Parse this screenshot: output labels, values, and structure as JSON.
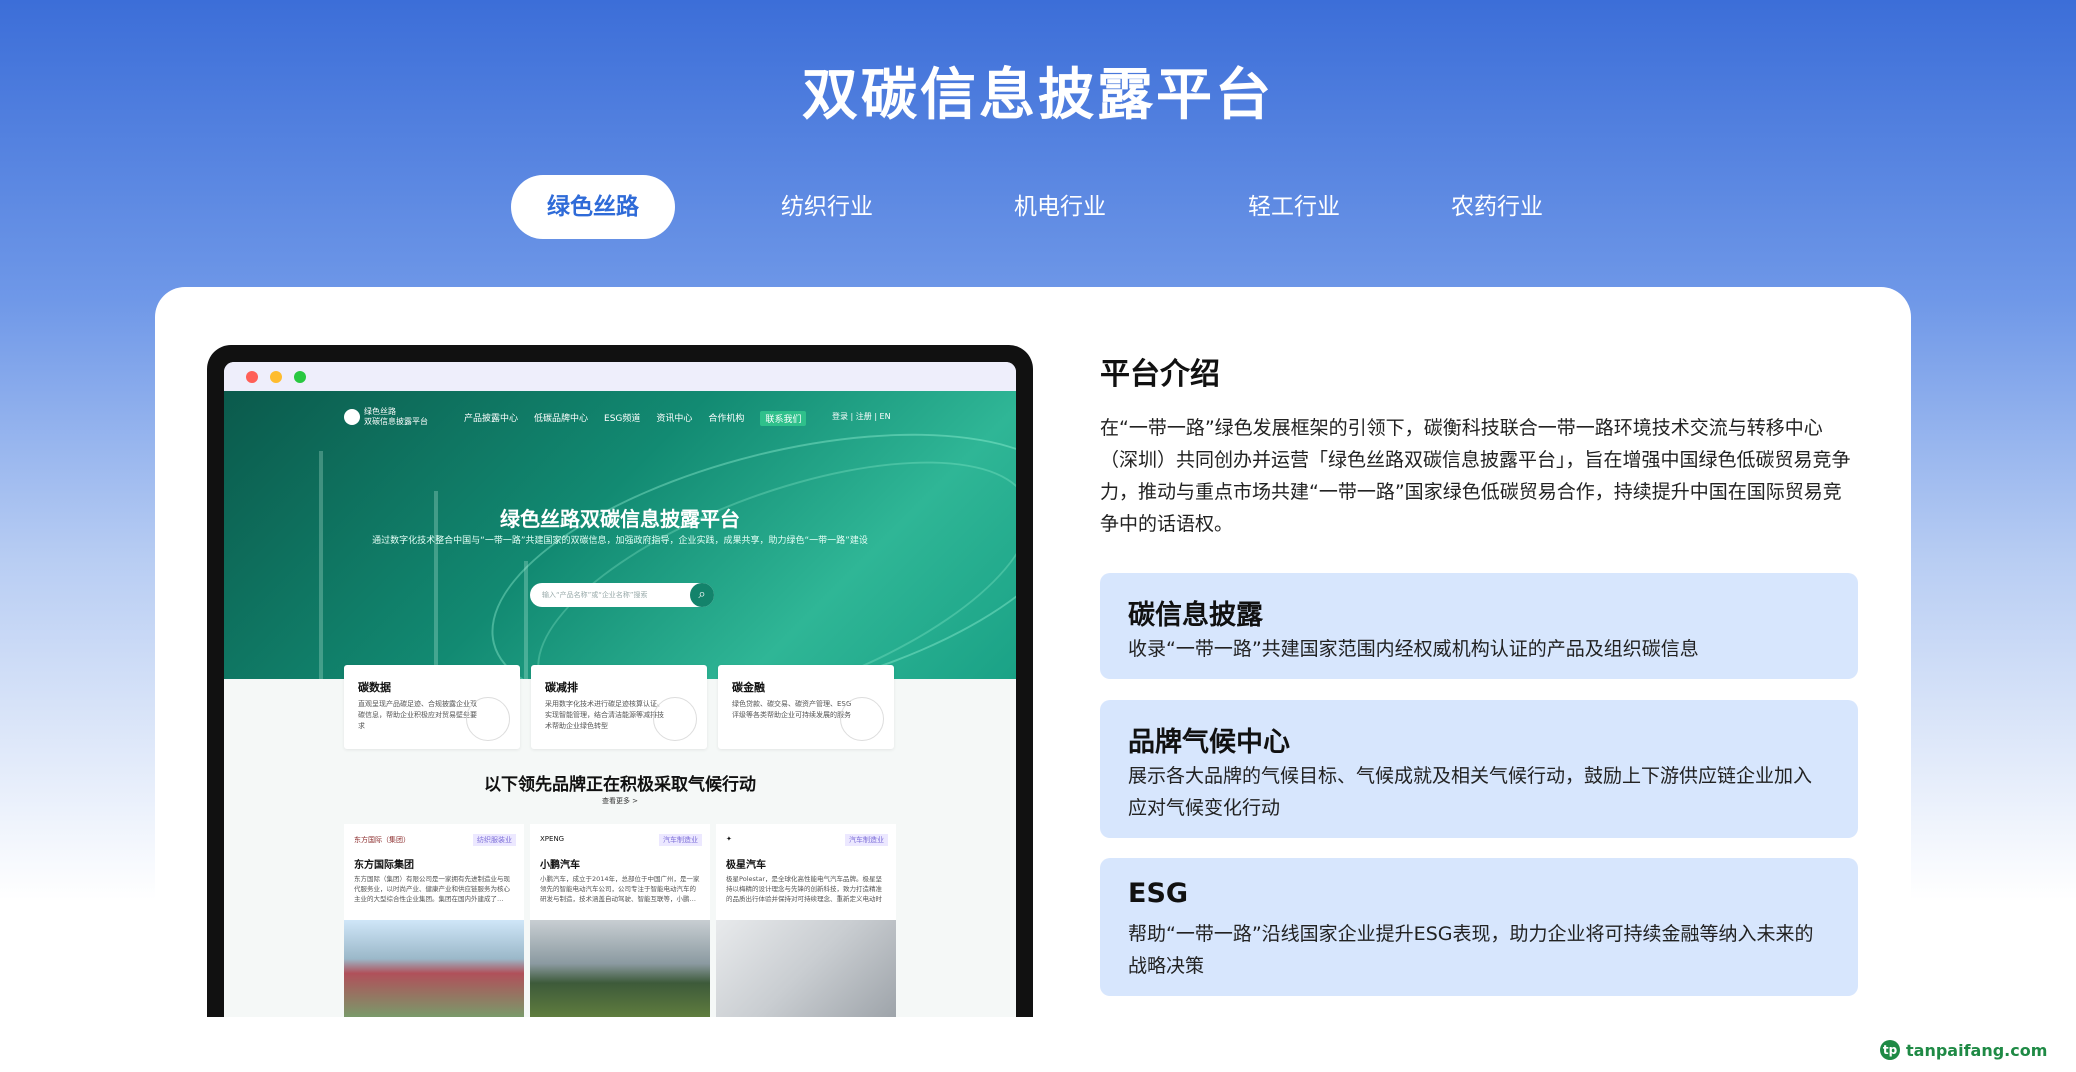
{
  "page_title": "双碳信息披露平台",
  "tabs": [
    {
      "label": "绿色丝路",
      "active": true
    },
    {
      "label": "纺织行业",
      "active": false
    },
    {
      "label": "机电行业",
      "active": false
    },
    {
      "label": "轻工行业",
      "active": false
    },
    {
      "label": "农药行业",
      "active": false
    }
  ],
  "mockup": {
    "logo_line1": "绿色丝路",
    "logo_line2": "双碳信息披露平台",
    "nav": [
      "产品披露中心",
      "低碳品牌中心",
      "ESG频道",
      "资讯中心",
      "合作机构"
    ],
    "nav_cta": "联系我们",
    "login": "登录 | 注册 | EN",
    "hero_title": "绿色丝路双碳信息披露平台",
    "hero_sub": "通过数字化技术整合中国与“一带一路”共建国家的双碳信息，加强政府指导，企业实践，成果共享，助力绿色“一带一路”建设",
    "search_placeholder": "输入“产品名称”或“企业名称”搜索",
    "features": [
      {
        "title": "碳数据",
        "desc": "直观呈现产品碳足迹、合规披露企业双碳信息，帮助企业积极应对贸易壁垒要求"
      },
      {
        "title": "碳减排",
        "desc": "采用数字化技术进行碳足迹核算认证、实现智能管理，结合清洁能源等减排技术帮助企业绿色转型"
      },
      {
        "title": "碳金融",
        "desc": "绿色贷款、碳交易、碳资产管理、ESG评级等各类帮助企业可持续发展的服务"
      }
    ],
    "section_title": "以下领先品牌正在积极采取气候行动",
    "more": "查看更多 >",
    "brands": [
      {
        "logo": "东方国际（集团）",
        "tag": "纺织服装业",
        "name": "东方国际集团",
        "desc": "东方国际（集团）有限公司是一家拥有先进制造业与现代服务业，以时尚产业、健康产业和供应链服务为核心主业的大型综合性企业集团。集团在国内外建成了…"
      },
      {
        "logo": "XPENG",
        "tag": "汽车制造业",
        "name": "小鹏汽车",
        "desc": "小鹏汽车，成立于2014年，总部位于中国广州，是一家领先的智能电动汽车公司，公司专注于智能电动汽车的研发与制造，技术涵盖自动驾驶、智能互联等，小鹏…"
      },
      {
        "logo": "✦",
        "tag": "汽车制造业",
        "name": "极星汽车",
        "desc": "极星Polestar，是全球化高性能电气汽车品牌。极星坚持以梅精的设计理念与先锋的创新科技，致力打造精准的品质出行体验并保持对可持续理念、重新定义电动时代…"
      }
    ]
  },
  "intro": {
    "title": "平台介绍",
    "text": "在“一带一路”绿色发展框架的引领下，碳衡科技联合一带一路环境技术交流与转移中心（深圳）共同创办并运营「绿色丝路双碳信息披露平台」，旨在增强中国绿色低碳贸易竞争力，推动与重点市场共建“一带一路”国家绿色低碳贸易合作，持续提升中国在国际贸易竞争中的话语权。"
  },
  "features": [
    {
      "title": "碳信息披露",
      "desc": "收录“一带一路”共建国家范围内经权威机构认证的产品及组织碳信息"
    },
    {
      "title": "品牌气候中心",
      "desc": "展示各大品牌的气候目标、气候成就及相关气候行动，鼓励上下游供应链企业加入应对气候变化行动"
    },
    {
      "title": "ESG",
      "desc": "帮助“一带一路”沿线国家企业提升ESG表现，助力企业将可持续金融等纳入未来的战略决策"
    }
  ],
  "watermark": "tanpaifang.com",
  "colors": {
    "accent": "#2f6bd8",
    "hero_green": "#128a72",
    "feature_bg": "#d7e6fd"
  }
}
